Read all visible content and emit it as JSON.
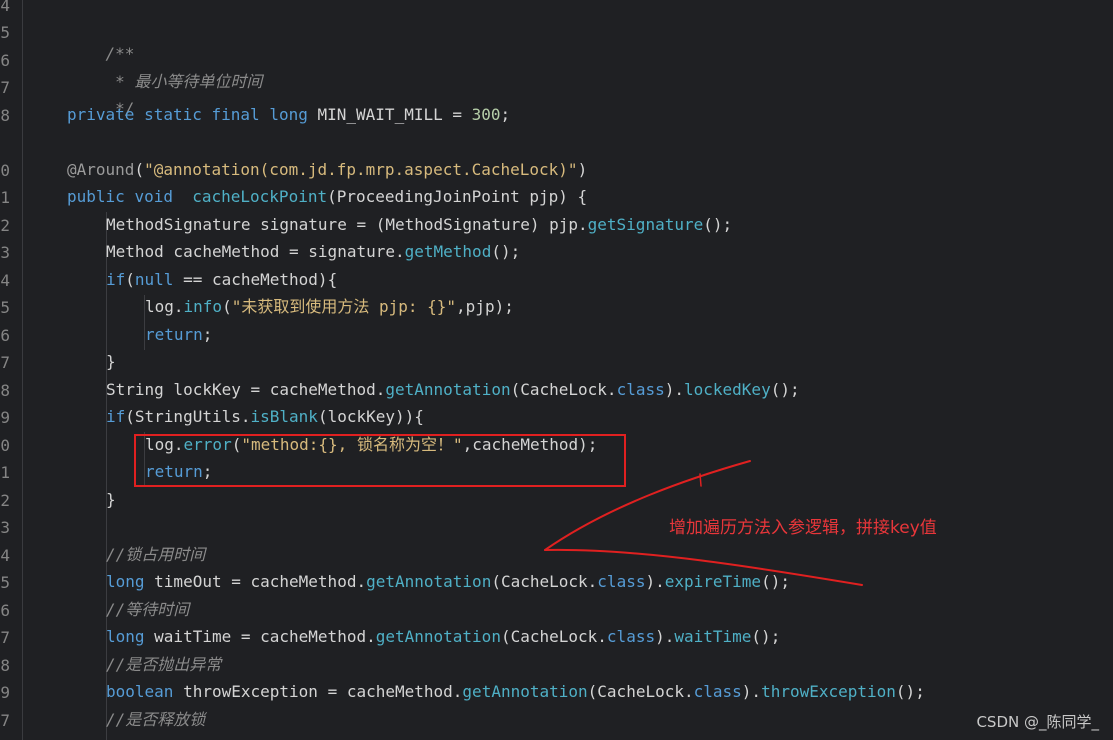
{
  "gutter": {
    "line_numbers": [
      "4",
      "5",
      "6",
      "7",
      "8",
      "",
      "0",
      "1",
      "2",
      "3",
      "4",
      "5",
      "6",
      "7",
      "8",
      "9",
      "0",
      "1",
      "2",
      "3",
      "4",
      "5",
      "6",
      "7",
      "8",
      "9",
      ""
    ]
  },
  "code": {
    "comment_open": "/**",
    "comment_desc": " * 最小等待单位时间",
    "comment_close": " */",
    "l4": {
      "private": "private",
      "static": "static",
      "final": "final",
      "long": "long",
      "name": "MIN_WAIT_MILL",
      "eq": " = ",
      "value": "300",
      "semi": ";"
    },
    "l6": {
      "annotation": "@Around",
      "open": "(",
      "str": "\"@annotation(com.jd.fp.mrp.aspect.CacheLock)\"",
      "close": ")"
    },
    "l7": {
      "public": "public",
      "void": "void",
      "method": "cacheLockPoint",
      "sig": "(ProceedingJoinPoint pjp) {"
    },
    "l8": {
      "a": "MethodSignature signature = (MethodSignature) pjp.",
      "f": "getSignature",
      "b": "();"
    },
    "l9": {
      "a": "Method cacheMethod = signature.",
      "f": "getMethod",
      "b": "();"
    },
    "l10": {
      "if": "if",
      "a": "(",
      "null": "null",
      "b": " == cacheMethod){"
    },
    "l11": {
      "log": "log.",
      "f": "info",
      "a": "(",
      "str": "\"未获取到使用方法 pjp: {}\"",
      "b": ",pjp);"
    },
    "l12": {
      "ret": "return",
      "b": ";"
    },
    "l13": "}",
    "l14": {
      "a": "String lockKey = cacheMethod.",
      "f1": "getAnnotation",
      "b": "(CacheLock.",
      "cls": "class",
      "c": ").",
      "f2": "lockedKey",
      "d": "();"
    },
    "l15": {
      "if": "if",
      "a": "(StringUtils.",
      "f": "isBlank",
      "b": "(lockKey)){"
    },
    "l16": {
      "log": "log.",
      "f": "error",
      "a": "(",
      "str": "\"method:{}, 锁名称为空！\"",
      "b": ",cacheMethod);"
    },
    "l17": {
      "ret": "return",
      "b": ";"
    },
    "l18": "}",
    "l20": "//锁占用时间",
    "l21": {
      "long": "long",
      "a": " timeOut = cacheMethod.",
      "f1": "getAnnotation",
      "b": "(CacheLock.",
      "cls": "class",
      "c": ").",
      "f2": "expireTime",
      "d": "();"
    },
    "l22": "//等待时间",
    "l23": {
      "long": "long",
      "a": " waitTime = cacheMethod.",
      "f1": "getAnnotation",
      "b": "(CacheLock.",
      "cls": "class",
      "c": ").",
      "f2": "waitTime",
      "d": "();"
    },
    "l24": "//是否抛出异常",
    "l25": {
      "boolean": "boolean",
      "a": " throwException = cacheMethod.",
      "f1": "getAnnotation",
      "b": "(CacheLock.",
      "cls": "class",
      "c": ").",
      "f2": "throwException",
      "d": "();"
    },
    "l26": "//是否释放锁"
  },
  "annotation": {
    "text": "增加遍历方法入参逻辑，拼接key值",
    "color": "#e8363a"
  },
  "highlight": {
    "color": "#e02020"
  },
  "watermark": "CSDN @_陈同学_"
}
